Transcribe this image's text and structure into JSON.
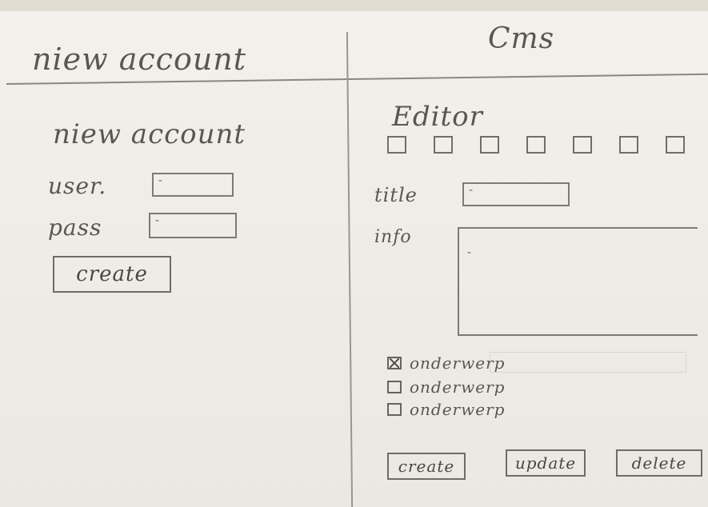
{
  "header": {
    "left_title": "niew account",
    "right_title": "Cms"
  },
  "left_panel": {
    "heading": "niew account",
    "user_label": "user.",
    "user_value": "-",
    "pass_label": "pass",
    "pass_value": "-",
    "create_button": "create"
  },
  "editor": {
    "heading": "Editor",
    "toolbar": {
      "buttons": [
        "tool-1",
        "tool-2",
        "tool-3",
        "tool-4",
        "tool-5",
        "tool-6",
        "tool-7"
      ]
    },
    "title_label": "title",
    "title_value": "-",
    "info_label": "info",
    "info_value": "-",
    "subjects": [
      {
        "label": "onderwerp",
        "checked": true
      },
      {
        "label": "onderwerp",
        "checked": false
      },
      {
        "label": "onderwerp",
        "checked": false
      }
    ],
    "buttons": {
      "create": "create",
      "update": "update",
      "delete": "delete"
    }
  }
}
